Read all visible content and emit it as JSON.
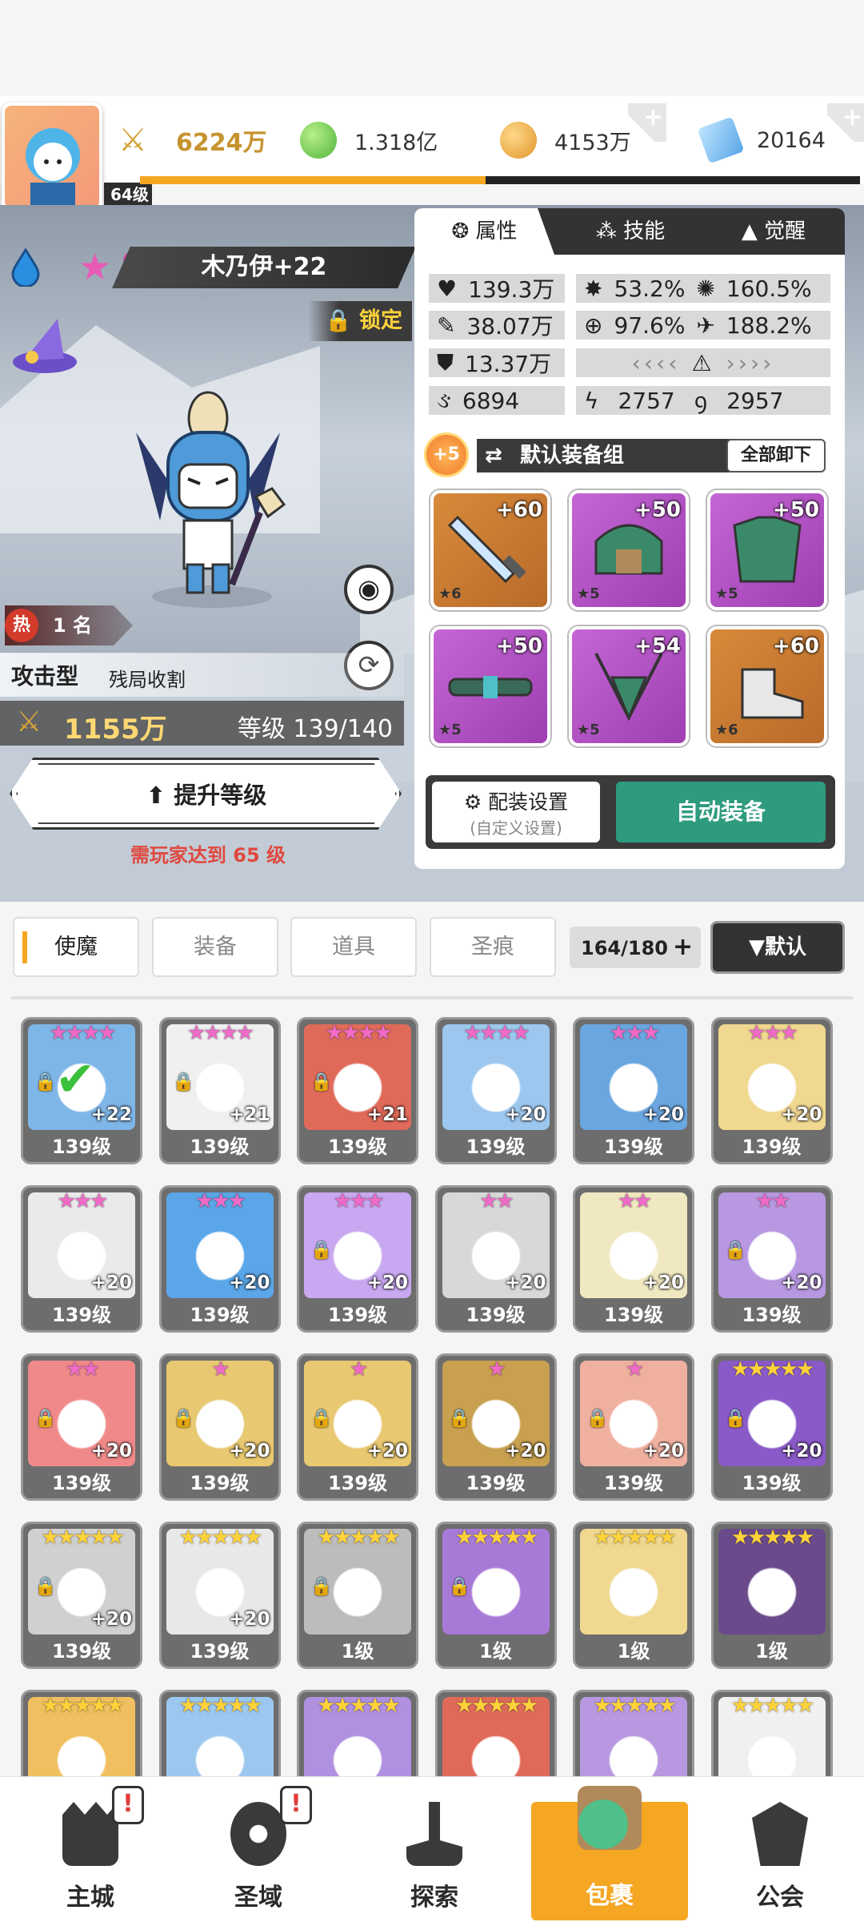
{
  "header": {
    "player_level": "64级",
    "xp_fraction": 0.48,
    "currencies": [
      {
        "name": "power",
        "icon": "sword-power-icon",
        "value": "6224万",
        "bold": true
      },
      {
        "name": "green-gem",
        "icon": "green-orb-icon",
        "value": "1.318亿"
      },
      {
        "name": "gold",
        "icon": "gold-coin-icon",
        "value": "4153万"
      },
      {
        "name": "diamond",
        "icon": "blue-crystal-icon",
        "value": "20164"
      }
    ]
  },
  "character": {
    "element_icon": "water-drop-icon",
    "stars": "9",
    "name": "木乃伊+22",
    "lock_label": "锁定",
    "hot_rank": "1 名",
    "hot_label": "热",
    "type": "攻击型",
    "trait": "残局收割",
    "power": "1155万",
    "level_text": "等级 139/140",
    "upgrade_label": "提升等级",
    "requirement": "需玩家达到 65 级"
  },
  "panel": {
    "tabs": [
      "属性",
      "技能",
      "觉醒"
    ],
    "stats": [
      {
        "icon": "heart-icon",
        "value": "139.3万"
      },
      {
        "icon": "crit-burst-icon",
        "value": "53.2%"
      },
      {
        "icon": "gear-burst-icon",
        "value": "160.5%"
      },
      {
        "icon": "attack-icon",
        "value": "38.07万"
      },
      {
        "icon": "target-icon",
        "value": "97.6%"
      },
      {
        "icon": "speed-icon",
        "value": "188.2%"
      },
      {
        "icon": "shield-icon",
        "value": "13.37万"
      },
      {
        "icon": "swirl-icon",
        "value": "6894"
      },
      {
        "icon": "slash-icon",
        "value": "2757"
      },
      {
        "icon": "spiral-icon",
        "value": "2957"
      }
    ],
    "equip_bonus": "+5",
    "equip_set_name": "默认装备组",
    "unequip_all": "全部卸下",
    "equipment": [
      {
        "level": "+60",
        "stars": "★6",
        "rarity": "gold"
      },
      {
        "level": "+50",
        "stars": "★5",
        "rarity": "purple"
      },
      {
        "level": "+50",
        "stars": "★5",
        "rarity": "purple"
      },
      {
        "level": "+50",
        "stars": "★5",
        "rarity": "purple"
      },
      {
        "level": "+54",
        "stars": "★5",
        "rarity": "purple"
      },
      {
        "level": "+60",
        "stars": "★6",
        "rarity": "gold"
      }
    ],
    "config_label": "配装设置",
    "config_sub": "(自定义设置)",
    "auto_equip": "自动装备"
  },
  "filters": {
    "tabs": [
      "使魔",
      "装备",
      "道具",
      "圣痕"
    ],
    "count": "164/180",
    "sort": "▼默认"
  },
  "roster": [
    {
      "stars": "★★★★",
      "star_color": "pink",
      "lvl": "139级",
      "plus": "+22",
      "lock": true,
      "check": true
    },
    {
      "stars": "★★★★",
      "star_color": "pink",
      "lvl": "139级",
      "plus": "+21",
      "lock": true
    },
    {
      "stars": "★★★★",
      "star_color": "pink",
      "lvl": "139级",
      "plus": "+21",
      "lock": true
    },
    {
      "stars": "★★★★",
      "star_color": "pink",
      "lvl": "139级",
      "plus": "+20"
    },
    {
      "stars": "★★★",
      "star_color": "pink",
      "lvl": "139级",
      "plus": "+20"
    },
    {
      "stars": "★★★",
      "star_color": "pink",
      "lvl": "139级",
      "plus": "+20"
    },
    {
      "stars": "★★★",
      "star_color": "pink",
      "lvl": "139级",
      "plus": "+20"
    },
    {
      "stars": "★★★",
      "star_color": "pink",
      "lvl": "139级",
      "plus": "+20"
    },
    {
      "stars": "★★★",
      "star_color": "pink",
      "lvl": "139级",
      "plus": "+20",
      "lock": true
    },
    {
      "stars": "★★",
      "star_color": "pink",
      "lvl": "139级",
      "plus": "+20"
    },
    {
      "stars": "★★",
      "star_color": "pink",
      "lvl": "139级",
      "plus": "+20"
    },
    {
      "stars": "★★",
      "star_color": "pink",
      "lvl": "139级",
      "plus": "+20",
      "lock": true
    },
    {
      "stars": "★★",
      "star_color": "pink",
      "lvl": "139级",
      "plus": "+20",
      "lock": true
    },
    {
      "stars": "★",
      "star_color": "pink",
      "lvl": "139级",
      "plus": "+20",
      "lock": true
    },
    {
      "stars": "★",
      "star_color": "pink",
      "lvl": "139级",
      "plus": "+20",
      "lock": true
    },
    {
      "stars": "★",
      "star_color": "pink",
      "lvl": "139级",
      "plus": "+20",
      "lock": true
    },
    {
      "stars": "★",
      "star_color": "pink",
      "lvl": "139级",
      "plus": "+20",
      "lock": true
    },
    {
      "stars": "★★★★★",
      "star_color": "gold",
      "lvl": "139级",
      "plus": "+20",
      "lock": true
    },
    {
      "stars": "★★★★★",
      "star_color": "gold",
      "lvl": "139级",
      "plus": "+20",
      "lock": true
    },
    {
      "stars": "★★★★★",
      "star_color": "gold",
      "lvl": "139级",
      "plus": "+20"
    },
    {
      "stars": "★★★★★",
      "star_color": "gold",
      "lvl": "1级",
      "plus": "",
      "lock": true
    },
    {
      "stars": "★★★★★",
      "star_color": "gold",
      "lvl": "1级",
      "plus": "",
      "lock": true
    },
    {
      "stars": "★★★★★",
      "star_color": "gold",
      "lvl": "1级",
      "plus": ""
    },
    {
      "stars": "★★★★★",
      "star_color": "gold",
      "lvl": "1级",
      "plus": ""
    },
    {
      "stars": "★★★★★",
      "star_color": "gold",
      "lvl": "",
      "plus": ""
    },
    {
      "stars": "★★★★★",
      "star_color": "gold",
      "lvl": "",
      "plus": ""
    },
    {
      "stars": "★★★★★",
      "star_color": "gold",
      "lvl": "",
      "plus": ""
    },
    {
      "stars": "★★★★★",
      "star_color": "gold",
      "lvl": "",
      "plus": ""
    },
    {
      "stars": "★★★★★",
      "star_color": "gold",
      "lvl": "",
      "plus": ""
    },
    {
      "stars": "★★★★★",
      "star_color": "gold",
      "lvl": "",
      "plus": ""
    }
  ],
  "nav": [
    {
      "label": "主城",
      "icon": "castle-icon",
      "badge": "!"
    },
    {
      "label": "圣域",
      "icon": "sanctum-swirl-icon",
      "badge": "!"
    },
    {
      "label": "探索",
      "icon": "sword-anvil-icon"
    },
    {
      "label": "包裹",
      "icon": "backpack-slime-icon",
      "active": true
    },
    {
      "label": "公会",
      "icon": "guild-crest-icon"
    }
  ],
  "colors": {
    "accent_orange": "#f5a623",
    "auto_green": "#2e9b7f",
    "warn_red": "#e0483f",
    "lock_yellow": "#ffd23a"
  }
}
